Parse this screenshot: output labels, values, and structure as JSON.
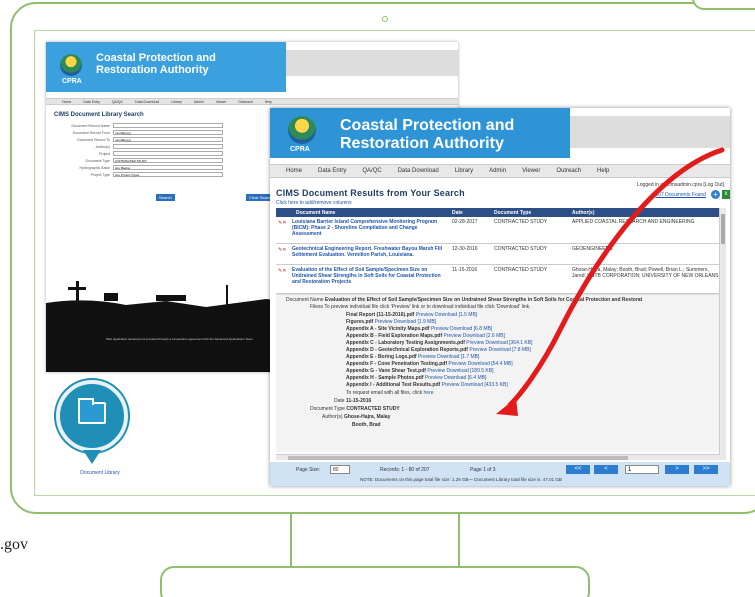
{
  "domain_text_left": ".gov",
  "back_window": {
    "title_line1": "Coastal Protection and",
    "title_line2": "Restoration Authority",
    "logo_text": "CPRA",
    "nav": [
      "Home",
      "Data Entry",
      "QA/QC",
      "Data Download",
      "Library",
      "Admin",
      "Viewer",
      "Outreach",
      "Help"
    ],
    "logged_in": "Logged in as cimsadmin.cpra [Log Out]",
    "page_title": "CIMS Document Library Search",
    "fields": [
      {
        "label": "Document Record Name",
        "value": ""
      },
      {
        "label": "Document Record From",
        "value": "mm/dd/yyyy"
      },
      {
        "label": "Document Record To",
        "value": "mm/dd/yyyy"
      },
      {
        "label": "Author(s)",
        "value": ""
      },
      {
        "label": "Project",
        "value": ""
      },
      {
        "label": "Document Type",
        "value": "CONTRACTED STUDY"
      },
      {
        "label": "Hydrographic Basin",
        "value": "ALL Basins"
      },
      {
        "label": "Project Type",
        "value": "ALL Project Types"
      }
    ],
    "search_btn": "Search",
    "clear_btn": "Clear Search Results",
    "footer1": "Web application development provided through a cooperative agreement with the Advanced Applications Team",
    "footer2": "For assistance, contact"
  },
  "front_window": {
    "title_line1": "Coastal Protection and",
    "title_line2": "Restoration Authority",
    "logo_text": "CPRA",
    "nav": [
      "Home",
      "Data Entry",
      "QA/QC",
      "Data Download",
      "Library",
      "Admin",
      "Viewer",
      "Outreach",
      "Help"
    ],
    "logged_in": "Logged in as cimsadmin.cpra [Log Out]",
    "found": "207 Documents Found",
    "results_title": "CIMS Document Results from Your Search",
    "add_columns": "Click here to add/remove columns",
    "headers": [
      "Document Name",
      "Date",
      "Document Type",
      "Author(s)"
    ],
    "rows": [
      {
        "name": "Louisiana Barrier Island Comprehensive Monitoring Program (BICM): Phase 2 - Shoreline Compilation and Change Assessment",
        "date": "02-28-2017",
        "type": "CONTRACTED STUDY",
        "authors": "APPLIED COASTAL RESEARCH AND ENGINEERING"
      },
      {
        "name": "Geotechnical Engineering Report. Freshwater Bayou Marsh Fill Settlement Evaluation. Vermilion Parish, Louisiana.",
        "date": "12-30-2016",
        "type": "CONTRACTED STUDY",
        "authors": "GEOENGINEERS"
      },
      {
        "name": "Evaluation of the Effect of Soil Sample/Specimen Size on Undrained Shear Strengths in Soft Soils for Coastal Protection and Restoration Projects",
        "date": "11-15-2016",
        "type": "CONTRACTED STUDY",
        "authors": "Ghose-Hajra, Malay; Booth, Brad; Powell, Brian L.; Summers, Jared; HNTB CORPORATION; UNIVERSITY OF NEW ORLEANS"
      }
    ],
    "detail": {
      "doc_name_label": "Document Name",
      "doc_name": "Evaluation of the Effect of Soil Sample/Specimen Size on Undrained Shear Strengths in Soft Soils for Coastal Protection and Restorat",
      "files_label": "Filess",
      "files_hint": "To preview individual file click 'Preview' link or to download individual file click 'Download' link.",
      "files": [
        {
          "name": "Final Report (11-15-2016).pdf",
          "size": "[1.5 MB]"
        },
        {
          "name": "Figures.pdf",
          "size": "[1.9 MB]"
        },
        {
          "name": "Appendix A - Site Vicinity Maps.pdf",
          "size": "[6.8 MB]"
        },
        {
          "name": "Appendix B - Field Exploration Maps.pdf",
          "size": "[2.6 MB]"
        },
        {
          "name": "Appendix C - Laboratory Testing Assignments.pdf",
          "size": "[364.1 KB]"
        },
        {
          "name": "Appendix D - Geotechnical Exploration Reports.pdf",
          "size": "[7.8 MB]"
        },
        {
          "name": "Appendix E - Boring Logs.pdf",
          "size": "[1.7 MB]"
        },
        {
          "name": "Appendix F - Cone Penetration Testing.pdf",
          "size": "[54.4 MB]"
        },
        {
          "name": "Appendix G - Vane Shear Test.pdf",
          "size": "[189.5 KB]"
        },
        {
          "name": "Appendix H - Sample Photos.pdf",
          "size": "[6.4 MB]"
        },
        {
          "name": "Appendix I - Additional Test Results.pdf",
          "size": "[433.5 KB]"
        }
      ],
      "preview": "Preview",
      "download": "Download",
      "request_all": "To request email with all files, click",
      "here": "here",
      "date_label": "Date",
      "date": "11-15-2016",
      "doctype_label": "Document Type",
      "doctype": "CONTRACTED STUDY",
      "authors_label": "Author(s)",
      "authors": [
        "Ghose-Hajra, Malay",
        "Booth, Brad"
      ]
    },
    "pager": {
      "page_size_label": "Page Size:",
      "page_size": "80",
      "records": "Records: 1 - 80 of 207",
      "page_of": "Page 1 of 3",
      "current_page": "1",
      "first": "<<",
      "prev": "<",
      "next": ">",
      "last": ">>",
      "note": "NOTE: Documents on this page total file size: 1.26 GB— Document Library total file size is: 47.01 GB"
    }
  },
  "badge": {
    "label": "Document Library"
  },
  "colors": {
    "accent_blue": "#2f94d6",
    "arrow_red": "#e21b1b",
    "frame_green": "#8fbf6a",
    "table_header": "#2b4f86"
  }
}
